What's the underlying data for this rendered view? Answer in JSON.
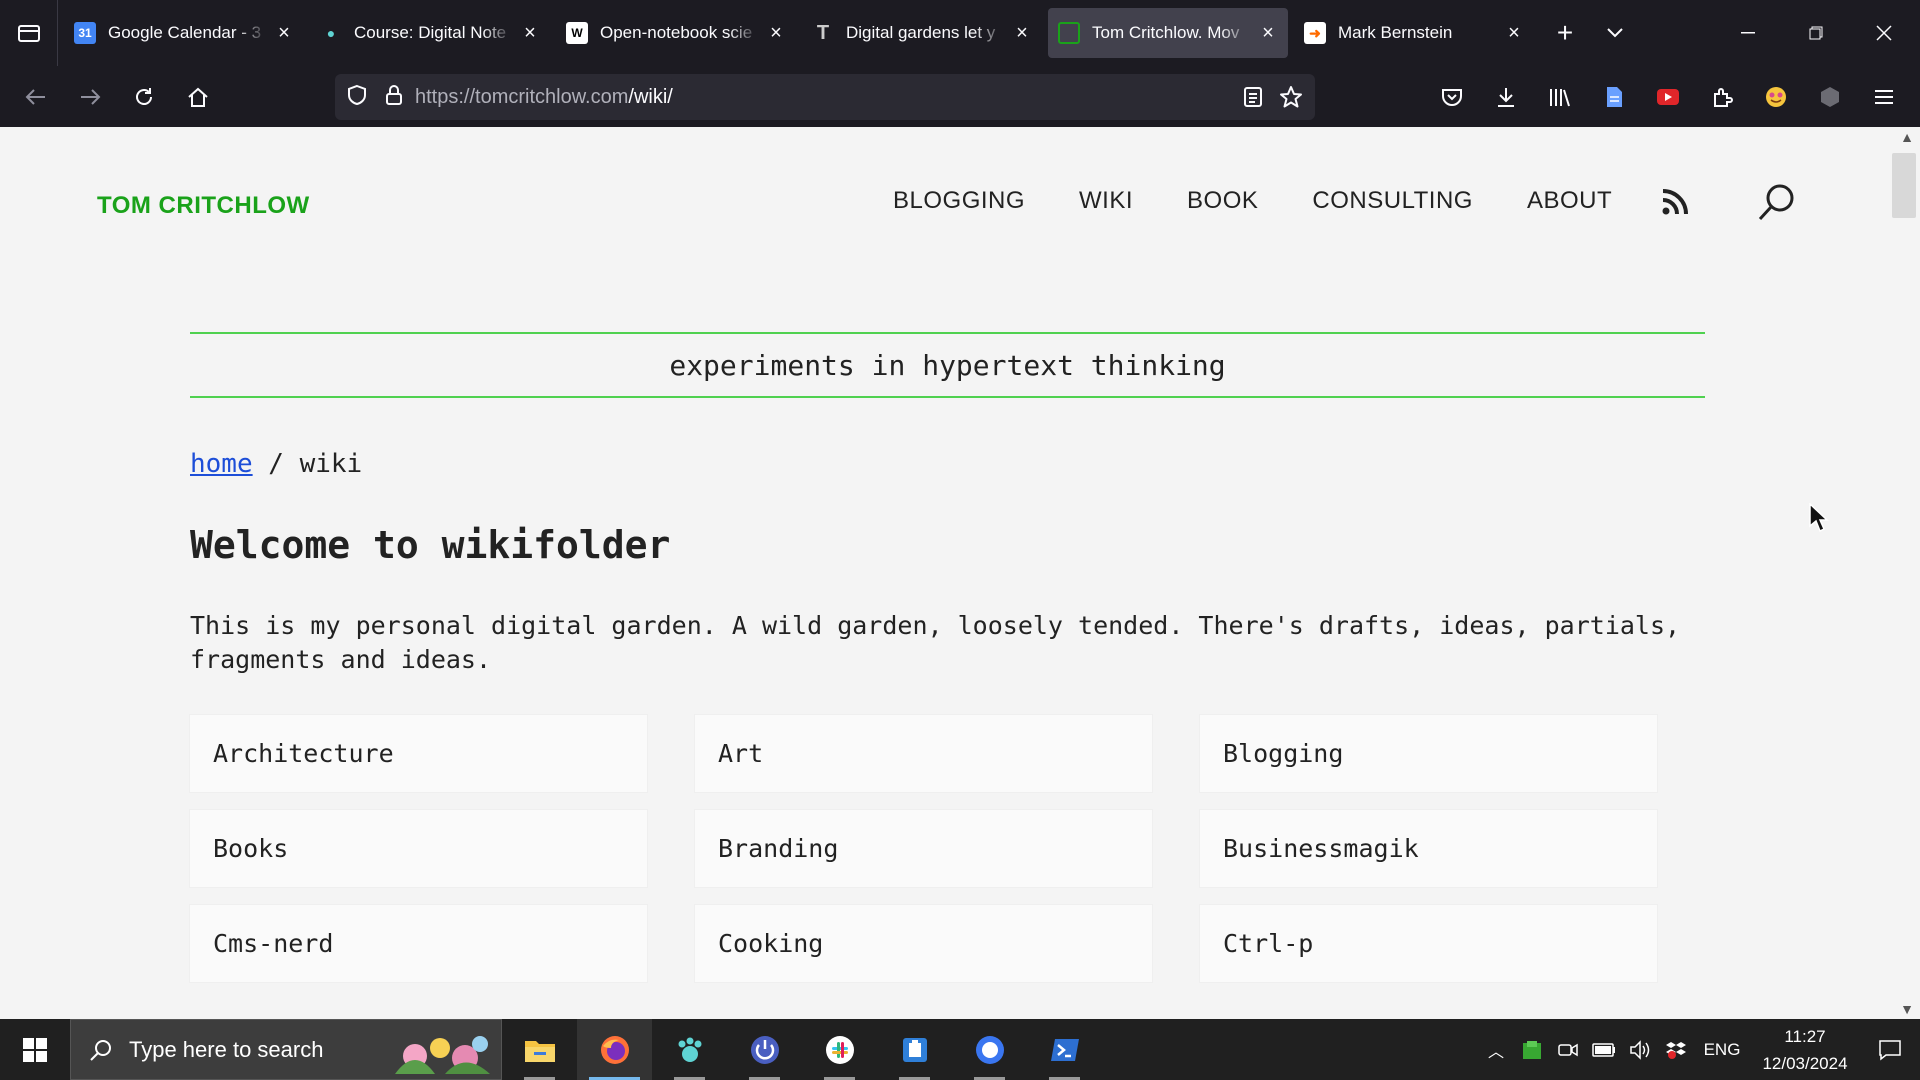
{
  "browser": {
    "tabs": [
      {
        "label": "Google Calendar - 3",
        "favicon": "calendar-icon",
        "favicon_text": "31",
        "favicon_color": "#4285f4",
        "active": false
      },
      {
        "label": "Course: Digital Note",
        "favicon": "paw-icon",
        "favicon_text": "",
        "favicon_color": "#5fd3d3",
        "active": false
      },
      {
        "label": "Open-notebook scie",
        "favicon": "wikipedia-icon",
        "favicon_text": "W",
        "favicon_color": "#ffffff",
        "active": false
      },
      {
        "label": "Digital gardens let y",
        "favicon": "t-icon",
        "favicon_text": "T",
        "favicon_color": "#cccccc",
        "active": false
      },
      {
        "label": "Tom Critchlow. Mov",
        "favicon": "green-square-icon",
        "favicon_text": "",
        "favicon_color": "#1aa21a",
        "active": true
      },
      {
        "label": "Mark Bernstein",
        "favicon": "arrow-icon",
        "favicon_text": "",
        "favicon_color": "#ff6b00",
        "active": false
      }
    ],
    "url_host": "https://tomcritchlow.com",
    "url_path": "/wiki/"
  },
  "site": {
    "logo": "TOM CRITCHLOW",
    "nav": [
      "BLOGGING",
      "WIKI",
      "BOOK",
      "CONSULTING",
      "ABOUT"
    ],
    "tagline": "experiments in hypertext thinking",
    "breadcrumb_home": "home",
    "breadcrumb_sep": " / wiki",
    "title": "Welcome to wikifolder",
    "intro": "This is my personal digital garden. A wild garden, loosely tended. There's drafts, ideas, partials, fragments and ideas.",
    "categories": [
      "Architecture",
      "Art",
      "Blogging",
      "Books",
      "Branding",
      "Businessmagik",
      "Cms-nerd",
      "Cooking",
      "Ctrl-p"
    ],
    "accent": "#1aa21a",
    "rule_color": "#4fd14f",
    "link_color": "#1d4ed8"
  },
  "taskbar": {
    "search_placeholder": "Type here to search",
    "language": "ENG",
    "time": "11:27",
    "date": "12/03/2024",
    "apps": [
      "file-explorer-icon",
      "firefox-icon",
      "paw-app-icon",
      "power-app-icon",
      "slack-icon",
      "clipboard-app-icon",
      "signal-icon",
      "powershell-icon"
    ]
  }
}
